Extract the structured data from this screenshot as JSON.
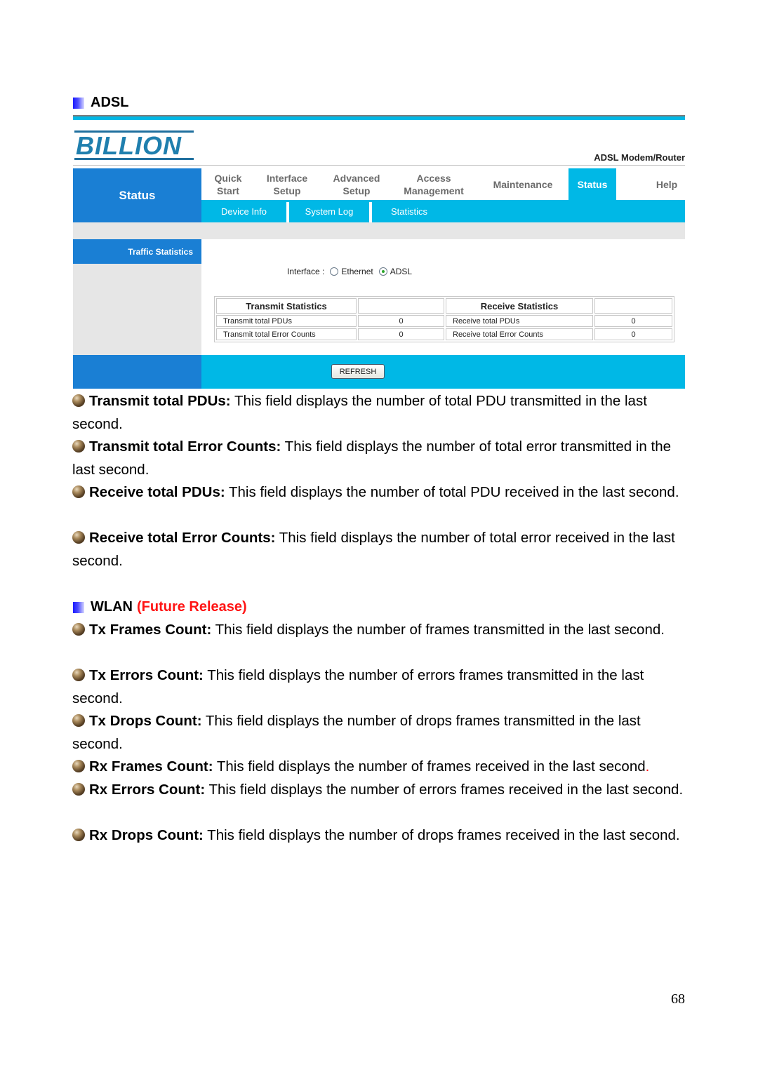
{
  "sections": {
    "adsl_heading": "ADSL",
    "wlan_heading": "WLAN",
    "wlan_note": "(Future Release)"
  },
  "router": {
    "brand_logo": "BILLION",
    "model": "ADSL Modem/Router",
    "section_title": "Status",
    "main_nav": [
      {
        "line1": "Quick",
        "line2": "Start"
      },
      {
        "line1": "Interface",
        "line2": "Setup"
      },
      {
        "line1": "Advanced",
        "line2": "Setup"
      },
      {
        "line1": "Access",
        "line2": "Management"
      },
      {
        "line1": "Maintenance",
        "line2": ""
      },
      {
        "line1": "Status",
        "line2": "",
        "active": true
      },
      {
        "line1": "Help",
        "line2": ""
      }
    ],
    "sub_nav": [
      "Device Info",
      "System Log",
      "Statistics"
    ],
    "left_menu": [
      "Traffic Statistics"
    ],
    "interface_label": "Interface :",
    "interface_options": [
      {
        "label": "Ethernet",
        "checked": false
      },
      {
        "label": "ADSL",
        "checked": true
      }
    ],
    "table": {
      "transmit_header": "Transmit Statistics",
      "receive_header": "Receive Statistics",
      "rows": [
        {
          "tx_label": "Transmit total PDUs",
          "tx_value": "0",
          "rx_label": "Receive total PDUs",
          "rx_value": "0"
        },
        {
          "tx_label": "Transmit total Error Counts",
          "tx_value": "0",
          "rx_label": "Receive total Error Counts",
          "rx_value": "0"
        }
      ]
    },
    "refresh_label": "REFRESH",
    "colors": {
      "dark_blue": "#1a7fd4",
      "cyan": "#00b8e6"
    }
  },
  "adsl_descriptions": [
    {
      "term": "Transmit total PDUs:",
      "text": " This field displays the number of total PDU transmitted in the last second."
    },
    {
      "term": "Transmit total Error Counts:",
      "text": " This field displays the number of total error transmitted in the last second."
    },
    {
      "term": "Receive total PDUs:",
      "text": " This field displays the number of total PDU received in the last second."
    },
    {
      "term": "Receive total Error Counts:",
      "text": " This field displays the number of total error received in the last second."
    }
  ],
  "wlan_descriptions": [
    {
      "term": "Tx Frames Count:",
      "text": " This field displays the number of frames transmitted in the last second."
    },
    {
      "term": "Tx Errors Count:",
      "text": " This field displays the number of errors frames transmitted in the last second."
    },
    {
      "term": "Tx Drops Count:",
      "text": " This field displays the number of drops frames transmitted in the last second."
    },
    {
      "term": "Rx Frames Count:",
      "text": " This field displays the number of frames received in the last second",
      "trail": "."
    },
    {
      "term": "Rx Errors Count:",
      "text": " This field displays the number of errors frames received in the last second."
    },
    {
      "term": "Rx Drops Count:",
      "text": " This field displays the number of drops frames received in the last second."
    }
  ],
  "page_number": "68"
}
